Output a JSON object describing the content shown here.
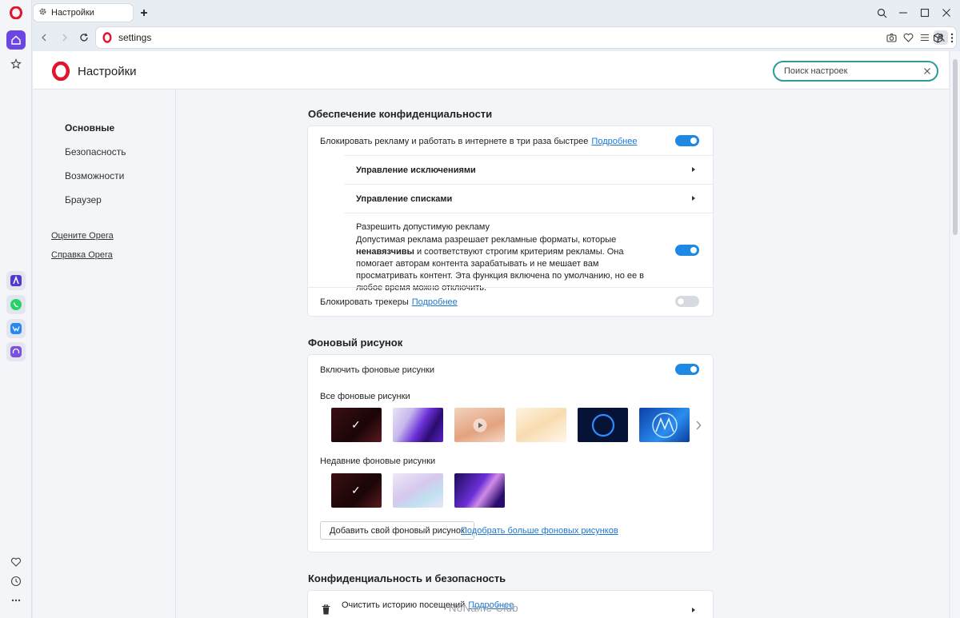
{
  "tab": {
    "title": "Настройки"
  },
  "address": {
    "url": "settings"
  },
  "page": {
    "title": "Настройки"
  },
  "search": {
    "placeholder": "Поиск настроек"
  },
  "left_nav": {
    "items": [
      {
        "label": "Основные",
        "active": true
      },
      {
        "label": "Безопасность",
        "active": false
      },
      {
        "label": "Возможности",
        "active": false
      },
      {
        "label": "Браузер",
        "active": false
      }
    ],
    "links": [
      "Оцените Opera",
      "Справка Opera"
    ]
  },
  "privacy": {
    "title": "Обеспечение конфиденциальности",
    "block_ads": {
      "label": "Блокировать рекламу и работать в интернете в три раза быстрее",
      "link": "Подробнее",
      "enabled": true
    },
    "manage_exceptions": "Управление исключениями",
    "manage_lists": "Управление списками",
    "acceptable_ads": {
      "title": "Разрешить допустимую рекламу",
      "desc_before": "Допустимая реклама разрешает рекламные форматы, которые",
      "desc_bold": "ненавязчивы",
      "desc_after": "и соответствуют строгим критериям рекламы. Она помогает авторам контента зарабатывать и не мешает вам просматривать контент. Эта функция включена по умолчанию, но ее в любое время можно отключить.",
      "enabled": true
    },
    "block_trackers": {
      "label": "Блокировать трекеры",
      "link": "Подробнее",
      "enabled": false
    }
  },
  "wallpaper": {
    "title": "Фоновый рисунок",
    "enable": {
      "label": "Включить фоновые рисунки",
      "enabled": true
    },
    "all_label": "Все фоновые рисунки",
    "recent_label": "Недавние фоновые рисунки",
    "add_button": "Добавить свой фоновый рисунок",
    "more_link": "Подобрать больше фоновых рисунков"
  },
  "security": {
    "title": "Конфиденциальность и безопасность",
    "clear_history": {
      "label": "Очистить историю посещений",
      "link": "Подробнее"
    }
  },
  "watermark": "NoName Club",
  "colors": {
    "accent": "#1e88e5",
    "search_border": "#2e9b97",
    "opera_red": "#e3132d",
    "link": "#1976d2"
  }
}
